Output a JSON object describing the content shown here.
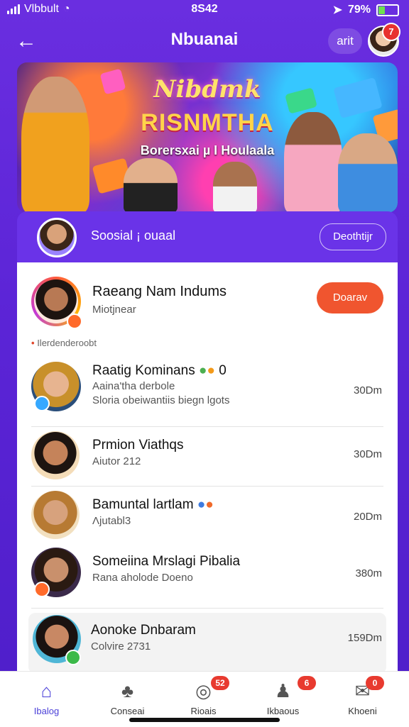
{
  "status_bar": {
    "carrier": "Vlbbult",
    "time": "8S42",
    "battery": "79%"
  },
  "header": {
    "title": "Nbuanai",
    "pill": "arit",
    "notification_count": "7"
  },
  "banner": {
    "line1": "Nibdmk",
    "line2": "RISNMTHA",
    "line3": "Borersxai µ I Houlaala"
  },
  "social_card": {
    "name": "Soosial ¡ ouaal",
    "button": "Deothtijr"
  },
  "top_user": {
    "name": "Raeang Nam Indums",
    "sub": "Miotjnear",
    "button": "Doarav"
  },
  "section_label": "Ilerdenderoobt",
  "list": [
    {
      "name": "Raatig Kominans",
      "emoji_count": "0",
      "line1": "Aaina'tha derbole",
      "line2": "Sloria obeiwantiis biegn lgots",
      "time": "30Dm"
    },
    {
      "name": "Prmion Viathqs",
      "line1": "Aiutor 212",
      "time": "30Dm"
    },
    {
      "name": "Bamuntal lartlam",
      "line1": "Λjutabl3",
      "time": "20Dm"
    },
    {
      "name": "Someiina Mrslagi Pibalia",
      "line1": "Rana aholode Doeno",
      "time": "380m"
    },
    {
      "name": "Aonoke Dnbaram",
      "line1": "Colvire 2731",
      "time": "159Dm"
    }
  ],
  "tabs": [
    {
      "label": "Ibalog",
      "icon": "home-icon",
      "badge": ""
    },
    {
      "label": "Conseai",
      "icon": "club-icon",
      "badge": ""
    },
    {
      "label": "Rioais",
      "icon": "radio-icon",
      "badge": "52"
    },
    {
      "label": "Ikbaous",
      "icon": "person-icon",
      "badge": "6"
    },
    {
      "label": "Khoeni",
      "icon": "chat-icon",
      "badge": "0"
    }
  ]
}
